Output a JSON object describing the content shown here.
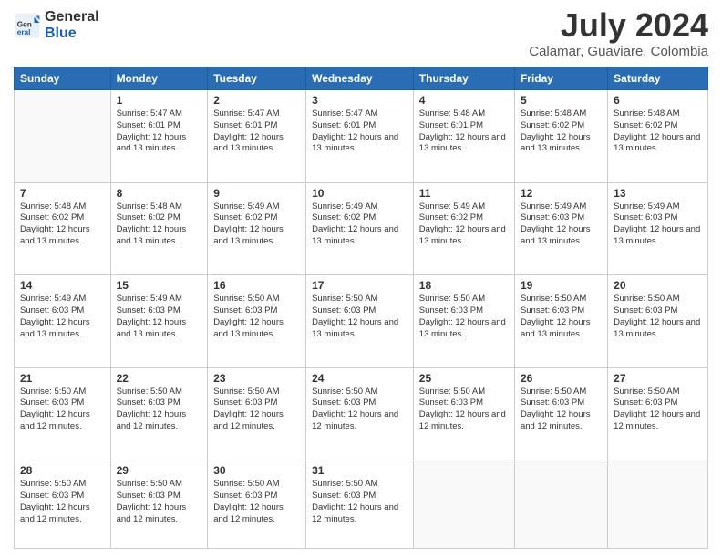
{
  "header": {
    "logo_general": "General",
    "logo_blue": "Blue",
    "month_year": "July 2024",
    "location": "Calamar, Guaviare, Colombia"
  },
  "days_of_week": [
    "Sunday",
    "Monday",
    "Tuesday",
    "Wednesday",
    "Thursday",
    "Friday",
    "Saturday"
  ],
  "weeks": [
    [
      {
        "day": "",
        "empty": true
      },
      {
        "day": "1",
        "sunrise": "Sunrise: 5:47 AM",
        "sunset": "Sunset: 6:01 PM",
        "daylight": "Daylight: 12 hours and 13 minutes."
      },
      {
        "day": "2",
        "sunrise": "Sunrise: 5:47 AM",
        "sunset": "Sunset: 6:01 PM",
        "daylight": "Daylight: 12 hours and 13 minutes."
      },
      {
        "day": "3",
        "sunrise": "Sunrise: 5:47 AM",
        "sunset": "Sunset: 6:01 PM",
        "daylight": "Daylight: 12 hours and 13 minutes."
      },
      {
        "day": "4",
        "sunrise": "Sunrise: 5:48 AM",
        "sunset": "Sunset: 6:01 PM",
        "daylight": "Daylight: 12 hours and 13 minutes."
      },
      {
        "day": "5",
        "sunrise": "Sunrise: 5:48 AM",
        "sunset": "Sunset: 6:02 PM",
        "daylight": "Daylight: 12 hours and 13 minutes."
      },
      {
        "day": "6",
        "sunrise": "Sunrise: 5:48 AM",
        "sunset": "Sunset: 6:02 PM",
        "daylight": "Daylight: 12 hours and 13 minutes."
      }
    ],
    [
      {
        "day": "7",
        "sunrise": "Sunrise: 5:48 AM",
        "sunset": "Sunset: 6:02 PM",
        "daylight": "Daylight: 12 hours and 13 minutes."
      },
      {
        "day": "8",
        "sunrise": "Sunrise: 5:48 AM",
        "sunset": "Sunset: 6:02 PM",
        "daylight": "Daylight: 12 hours and 13 minutes."
      },
      {
        "day": "9",
        "sunrise": "Sunrise: 5:49 AM",
        "sunset": "Sunset: 6:02 PM",
        "daylight": "Daylight: 12 hours and 13 minutes."
      },
      {
        "day": "10",
        "sunrise": "Sunrise: 5:49 AM",
        "sunset": "Sunset: 6:02 PM",
        "daylight": "Daylight: 12 hours and 13 minutes."
      },
      {
        "day": "11",
        "sunrise": "Sunrise: 5:49 AM",
        "sunset": "Sunset: 6:02 PM",
        "daylight": "Daylight: 12 hours and 13 minutes."
      },
      {
        "day": "12",
        "sunrise": "Sunrise: 5:49 AM",
        "sunset": "Sunset: 6:03 PM",
        "daylight": "Daylight: 12 hours and 13 minutes."
      },
      {
        "day": "13",
        "sunrise": "Sunrise: 5:49 AM",
        "sunset": "Sunset: 6:03 PM",
        "daylight": "Daylight: 12 hours and 13 minutes."
      }
    ],
    [
      {
        "day": "14",
        "sunrise": "Sunrise: 5:49 AM",
        "sunset": "Sunset: 6:03 PM",
        "daylight": "Daylight: 12 hours and 13 minutes."
      },
      {
        "day": "15",
        "sunrise": "Sunrise: 5:49 AM",
        "sunset": "Sunset: 6:03 PM",
        "daylight": "Daylight: 12 hours and 13 minutes."
      },
      {
        "day": "16",
        "sunrise": "Sunrise: 5:50 AM",
        "sunset": "Sunset: 6:03 PM",
        "daylight": "Daylight: 12 hours and 13 minutes."
      },
      {
        "day": "17",
        "sunrise": "Sunrise: 5:50 AM",
        "sunset": "Sunset: 6:03 PM",
        "daylight": "Daylight: 12 hours and 13 minutes."
      },
      {
        "day": "18",
        "sunrise": "Sunrise: 5:50 AM",
        "sunset": "Sunset: 6:03 PM",
        "daylight": "Daylight: 12 hours and 13 minutes."
      },
      {
        "day": "19",
        "sunrise": "Sunrise: 5:50 AM",
        "sunset": "Sunset: 6:03 PM",
        "daylight": "Daylight: 12 hours and 13 minutes."
      },
      {
        "day": "20",
        "sunrise": "Sunrise: 5:50 AM",
        "sunset": "Sunset: 6:03 PM",
        "daylight": "Daylight: 12 hours and 13 minutes."
      }
    ],
    [
      {
        "day": "21",
        "sunrise": "Sunrise: 5:50 AM",
        "sunset": "Sunset: 6:03 PM",
        "daylight": "Daylight: 12 hours and 12 minutes."
      },
      {
        "day": "22",
        "sunrise": "Sunrise: 5:50 AM",
        "sunset": "Sunset: 6:03 PM",
        "daylight": "Daylight: 12 hours and 12 minutes."
      },
      {
        "day": "23",
        "sunrise": "Sunrise: 5:50 AM",
        "sunset": "Sunset: 6:03 PM",
        "daylight": "Daylight: 12 hours and 12 minutes."
      },
      {
        "day": "24",
        "sunrise": "Sunrise: 5:50 AM",
        "sunset": "Sunset: 6:03 PM",
        "daylight": "Daylight: 12 hours and 12 minutes."
      },
      {
        "day": "25",
        "sunrise": "Sunrise: 5:50 AM",
        "sunset": "Sunset: 6:03 PM",
        "daylight": "Daylight: 12 hours and 12 minutes."
      },
      {
        "day": "26",
        "sunrise": "Sunrise: 5:50 AM",
        "sunset": "Sunset: 6:03 PM",
        "daylight": "Daylight: 12 hours and 12 minutes."
      },
      {
        "day": "27",
        "sunrise": "Sunrise: 5:50 AM",
        "sunset": "Sunset: 6:03 PM",
        "daylight": "Daylight: 12 hours and 12 minutes."
      }
    ],
    [
      {
        "day": "28",
        "sunrise": "Sunrise: 5:50 AM",
        "sunset": "Sunset: 6:03 PM",
        "daylight": "Daylight: 12 hours and 12 minutes."
      },
      {
        "day": "29",
        "sunrise": "Sunrise: 5:50 AM",
        "sunset": "Sunset: 6:03 PM",
        "daylight": "Daylight: 12 hours and 12 minutes."
      },
      {
        "day": "30",
        "sunrise": "Sunrise: 5:50 AM",
        "sunset": "Sunset: 6:03 PM",
        "daylight": "Daylight: 12 hours and 12 minutes."
      },
      {
        "day": "31",
        "sunrise": "Sunrise: 5:50 AM",
        "sunset": "Sunset: 6:03 PM",
        "daylight": "Daylight: 12 hours and 12 minutes."
      },
      {
        "day": "",
        "empty": true
      },
      {
        "day": "",
        "empty": true
      },
      {
        "day": "",
        "empty": true
      }
    ]
  ]
}
